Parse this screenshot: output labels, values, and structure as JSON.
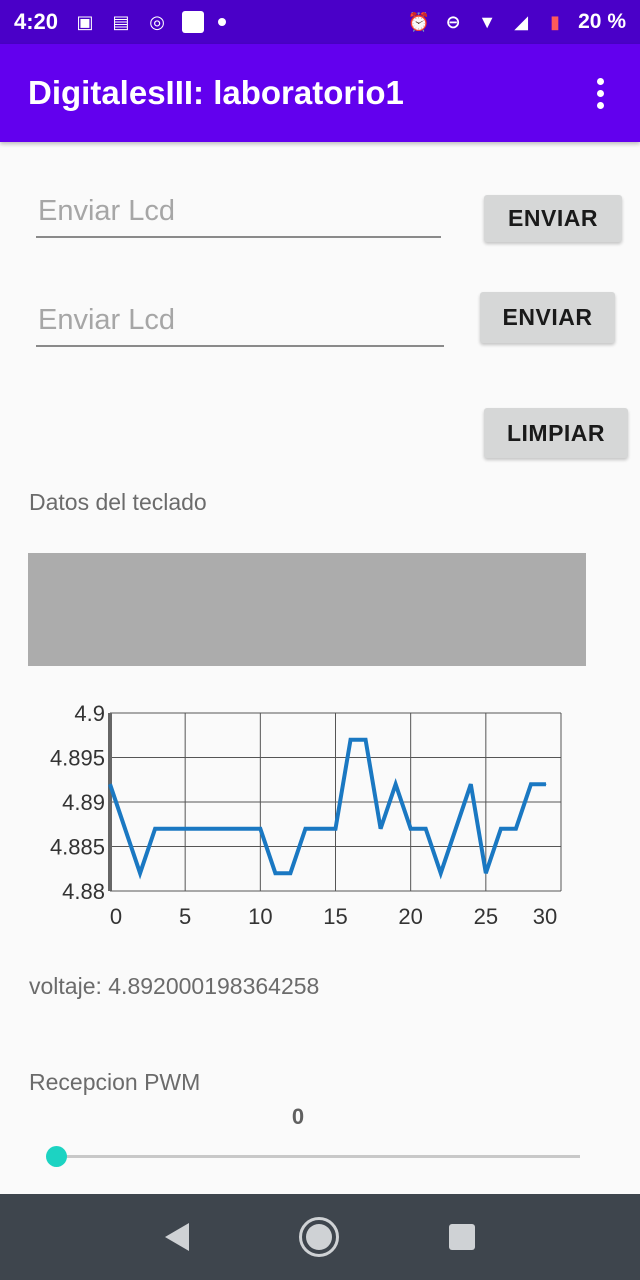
{
  "status_bar": {
    "time": "4:20",
    "battery": "20 %",
    "left_icons": [
      "image-icon",
      "news-icon",
      "whatsapp-icon",
      "app-square-icon",
      "dot-icon"
    ],
    "right_icons": [
      "alarm-icon",
      "dnd-icon",
      "wifi-icon",
      "signal-icon",
      "battery-icon"
    ]
  },
  "app_bar": {
    "title": "DigitalesIII: laboratorio1",
    "menu_icon": "more-vert-icon",
    "color": "#6200ee"
  },
  "form": {
    "input1": {
      "placeholder": "Enviar Lcd",
      "value": ""
    },
    "button1": "ENVIAR",
    "input2": {
      "placeholder": "Enviar Lcd",
      "value": ""
    },
    "button2": "ENVIAR",
    "clear_button": "LIMPIAR"
  },
  "keyboard_section": {
    "label": "Datos del teclado",
    "content": ""
  },
  "chart_data": {
    "type": "line",
    "title": "",
    "xlabel": "",
    "ylabel": "",
    "xlim": [
      0,
      30
    ],
    "ylim": [
      4.88,
      4.9
    ],
    "x_ticks": [
      "0",
      "5",
      "10",
      "15",
      "20",
      "25",
      "30"
    ],
    "y_ticks": [
      "4.9",
      "4.895",
      "4.89",
      "4.885",
      "4.88"
    ],
    "grid": true,
    "color": "#1a78c2",
    "x": [
      0,
      1,
      2,
      3,
      4,
      5,
      6,
      7,
      8,
      9,
      10,
      11,
      12,
      13,
      14,
      15,
      16,
      17,
      18,
      19,
      20,
      21,
      22,
      23,
      24,
      25,
      26,
      27,
      28,
      29
    ],
    "y": [
      4.892,
      4.887,
      4.882,
      4.887,
      4.887,
      4.887,
      4.887,
      4.887,
      4.887,
      4.887,
      4.887,
      4.882,
      4.882,
      4.887,
      4.887,
      4.887,
      4.897,
      4.897,
      4.887,
      4.892,
      4.887,
      4.887,
      4.882,
      4.887,
      4.892,
      4.882,
      4.887,
      4.887,
      4.892,
      4.892
    ]
  },
  "voltage_text": "voltaje: 4.892000198364258",
  "pwm": {
    "label": "Recepcion  PWM",
    "value": "0",
    "slider_fraction": 0,
    "accent": "#1cd3c2"
  },
  "nav_bar": {
    "icons": [
      "back-icon",
      "home-icon",
      "recents-icon"
    ]
  }
}
